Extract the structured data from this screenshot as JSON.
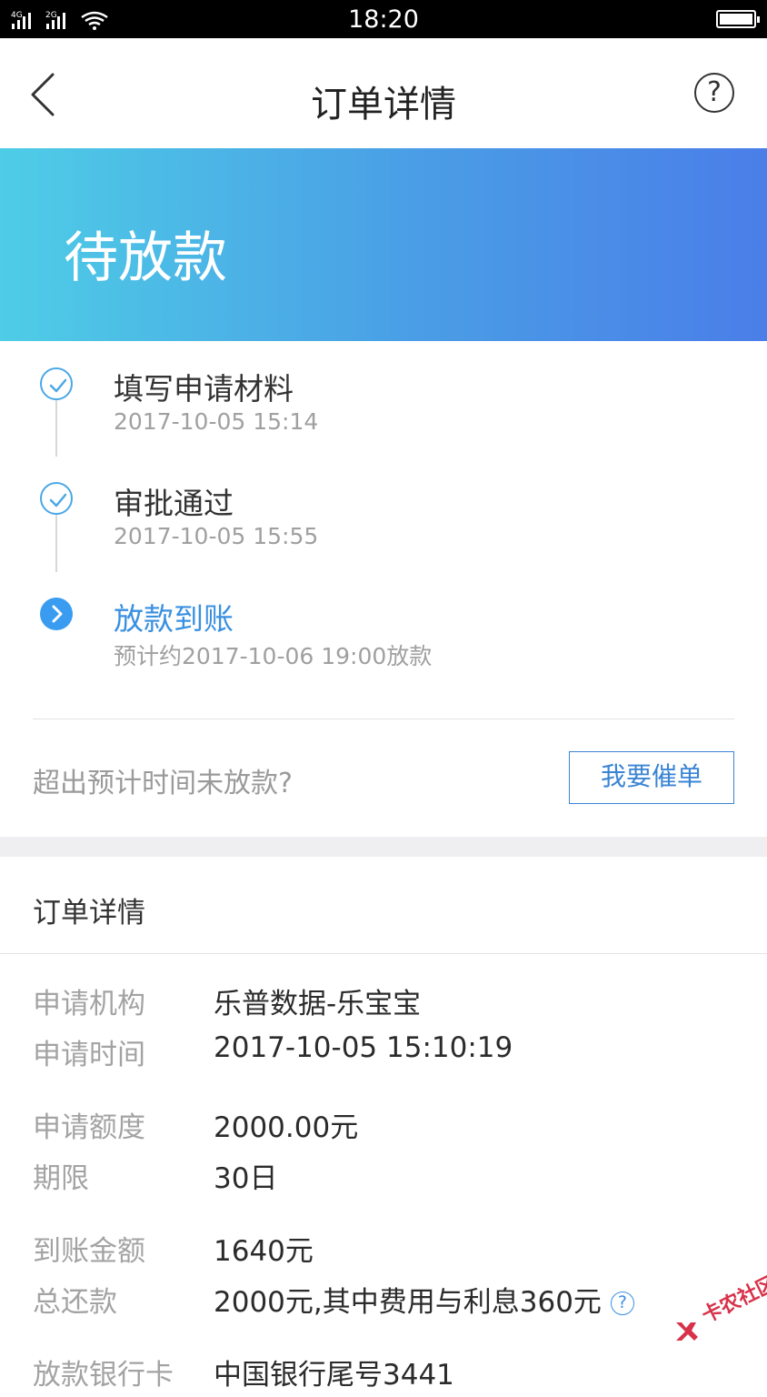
{
  "status_bar": {
    "signal_1": "4G",
    "signal_2": "2G",
    "time": "18:20"
  },
  "nav": {
    "title": "订单详情",
    "back_icon": "chevron-left-icon",
    "help_icon": "question-circle-icon",
    "help_symbol": "?"
  },
  "banner": {
    "title": "待放款"
  },
  "timeline": [
    {
      "label": "填写申请材料",
      "time": "2017-10-05 15:14",
      "state": "done"
    },
    {
      "label": "审批通过",
      "time": "2017-10-05 15:55",
      "state": "done"
    },
    {
      "label": "放款到账",
      "time": "预计约2017-10-06 19:00放款",
      "state": "active"
    }
  ],
  "overdue": {
    "text": "超出预计时间未放款?",
    "button": "我要催单"
  },
  "details": {
    "section_title": "订单详情",
    "rows": [
      {
        "label": "申请机构",
        "value": "乐普数据-乐宝宝"
      },
      {
        "label": "申请时间",
        "value": "2017-10-05 15:10:19"
      },
      {
        "label": "申请额度",
        "value": "2000.00元"
      },
      {
        "label": "期限",
        "value": "30日"
      },
      {
        "label": "到账金额",
        "value": "1640元"
      },
      {
        "label": "总还款",
        "value": "2000元,其中费用与利息360元"
      },
      {
        "label": "放款银行卡",
        "value": "中国银行尾号3441"
      }
    ],
    "info_symbol": "?"
  },
  "watermark": {
    "text": "卡农社区"
  },
  "colors": {
    "accent": "#3a90e0",
    "banner_start": "#4ecde6",
    "banner_end": "#4a7ee8"
  }
}
